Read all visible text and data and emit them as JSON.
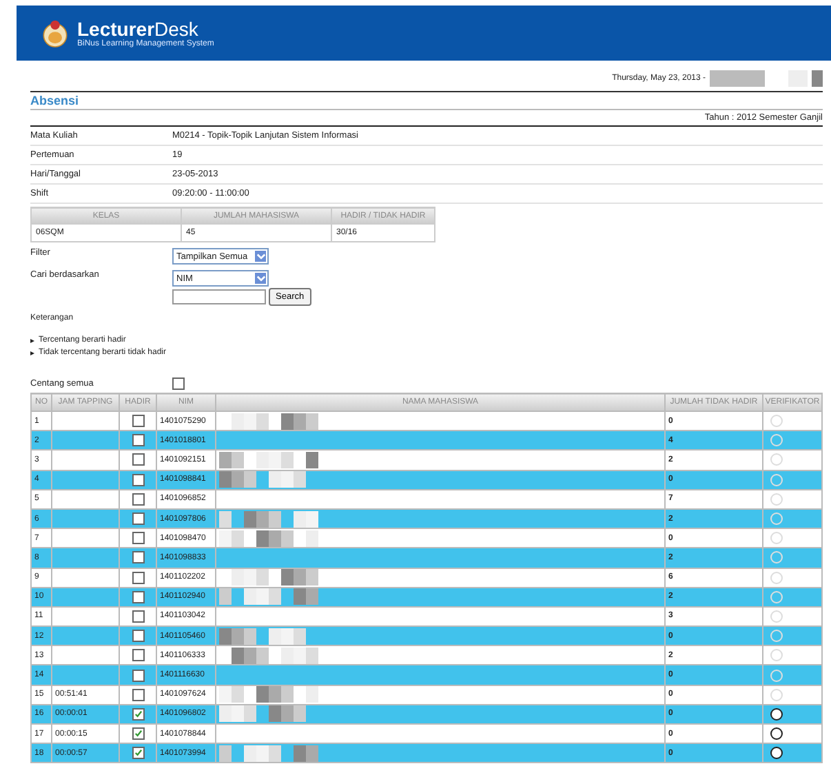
{
  "header": {
    "logo_title_bold": "Lecturer",
    "logo_title_rest": "Desk",
    "subtitle": "BiNus Learning Management System"
  },
  "date": "Thursday, May 23, 2013 -",
  "page_title": "Absensi",
  "period": "Tahun : 2012 Semester Ganjil",
  "info": [
    {
      "label": "Mata Kuliah",
      "value": "M0214 - Topik-Topik Lanjutan Sistem Informasi"
    },
    {
      "label": "Pertemuan",
      "value": "19"
    },
    {
      "label": "Hari/Tanggal",
      "value": "23-05-2013"
    },
    {
      "label": "Shift",
      "value": "09:20:00 - 11:00:00"
    }
  ],
  "class_table": {
    "columns": [
      "KELAS",
      "JUMLAH MAHASISWA",
      "HADIR / TIDAK HADIR"
    ],
    "row": [
      "06SQM",
      "45",
      "30/16"
    ]
  },
  "filter": {
    "label": "Filter",
    "value": "Tampilkan Semua"
  },
  "search_by": {
    "label": "Cari berdasarkan",
    "value": "NIM",
    "button": "Search"
  },
  "legend": {
    "title": "Keterangan",
    "bullet": "▸",
    "items": [
      "Tercentang berarti hadir",
      "Tidak tercentang berarti tidak hadir"
    ]
  },
  "check_all": {
    "label": "Centang semua",
    "checked": false
  },
  "table": {
    "columns": [
      "NO",
      "JAM TAPPING",
      "HADIR",
      "NIM",
      "NAMA MAHASISWA",
      "JUMLAH TIDAK HADIR",
      "VERIFIKATOR"
    ],
    "rows": [
      {
        "no": "1",
        "time": "",
        "present": false,
        "nim": "1401075290",
        "absent": "0",
        "verifier_disabled": true
      },
      {
        "no": "2",
        "time": "",
        "present": false,
        "nim": "1401018801",
        "absent": "4",
        "verifier_disabled": true
      },
      {
        "no": "3",
        "time": "",
        "present": false,
        "nim": "1401092151",
        "absent": "2",
        "verifier_disabled": true
      },
      {
        "no": "4",
        "time": "",
        "present": false,
        "nim": "1401098841",
        "absent": "0",
        "verifier_disabled": true
      },
      {
        "no": "5",
        "time": "",
        "present": false,
        "nim": "1401096852",
        "absent": "7",
        "verifier_disabled": true
      },
      {
        "no": "6",
        "time": "",
        "present": false,
        "nim": "1401097806",
        "absent": "2",
        "verifier_disabled": true
      },
      {
        "no": "7",
        "time": "",
        "present": false,
        "nim": "1401098470",
        "absent": "0",
        "verifier_disabled": true
      },
      {
        "no": "8",
        "time": "",
        "present": false,
        "nim": "1401098833",
        "absent": "2",
        "verifier_disabled": true
      },
      {
        "no": "9",
        "time": "",
        "present": false,
        "nim": "1401102202",
        "absent": "6",
        "verifier_disabled": true
      },
      {
        "no": "10",
        "time": "",
        "present": false,
        "nim": "1401102940",
        "absent": "2",
        "verifier_disabled": true
      },
      {
        "no": "11",
        "time": "",
        "present": false,
        "nim": "1401103042",
        "absent": "3",
        "verifier_disabled": true
      },
      {
        "no": "12",
        "time": "",
        "present": false,
        "nim": "1401105460",
        "absent": "0",
        "verifier_disabled": true
      },
      {
        "no": "13",
        "time": "",
        "present": false,
        "nim": "1401106333",
        "absent": "2",
        "verifier_disabled": true
      },
      {
        "no": "14",
        "time": "",
        "present": false,
        "nim": "1401116630",
        "absent": "0",
        "verifier_disabled": true
      },
      {
        "no": "15",
        "time": "00:51:41",
        "present": false,
        "nim": "1401097624",
        "absent": "0",
        "verifier_disabled": true
      },
      {
        "no": "16",
        "time": "00:00:01",
        "present": true,
        "nim": "1401096802",
        "absent": "0",
        "verifier_disabled": false
      },
      {
        "no": "17",
        "time": "00:00:15",
        "present": true,
        "nim": "1401078844",
        "absent": "0",
        "verifier_disabled": false
      },
      {
        "no": "18",
        "time": "00:00:57",
        "present": true,
        "nim": "1401073994",
        "absent": "0",
        "verifier_disabled": false
      }
    ]
  }
}
